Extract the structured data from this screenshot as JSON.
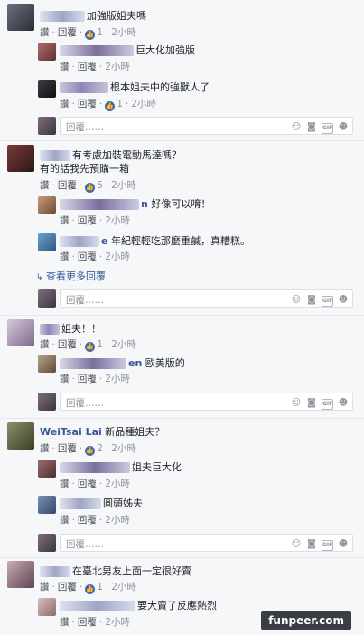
{
  "actions": {
    "like": "讚",
    "reply": "回覆"
  },
  "reply_placeholder": "回覆……",
  "icons": {
    "emoji": "smile-icon",
    "camera": "camera-icon",
    "gif": "gif-icon",
    "sticker": "sticker-icon"
  },
  "gif_text": "GIF",
  "threads": [
    {
      "comment": {
        "text": "加強版姐夫嗎",
        "likes": "1",
        "time": "2小時"
      },
      "replies": [
        {
          "text": "巨大化加強版",
          "likes": "",
          "time": "2小時"
        },
        {
          "text": "根本姐夫中的強獸人了",
          "likes": "1",
          "time": "2小時"
        }
      ]
    },
    {
      "comment": {
        "line1": "有考慮加裝電動馬達嗎？",
        "line2": "有的話我先預購一箱",
        "likes": "5",
        "time": "2小時"
      },
      "replies": [
        {
          "text": "好像可以唷！",
          "name_tail": "n",
          "likes": "",
          "time": "2小時"
        },
        {
          "text": "年紀輕輕吃那麼重鹹，真糟糕。",
          "name_tail": "e",
          "likes": "",
          "time": "2小時"
        }
      ],
      "more_replies": "查看更多回覆"
    },
    {
      "comment": {
        "text": "姐夫！！",
        "likes": "1",
        "time": "2小時"
      },
      "replies": [
        {
          "text": "歐美版的",
          "name_tail": "en",
          "likes": "",
          "time": "2小時"
        }
      ]
    },
    {
      "comment": {
        "author": "WeiTsai Lai",
        "text": "新品種姐夫？",
        "likes": "2",
        "time": "2小時"
      },
      "replies": [
        {
          "text": "姐夫巨大化",
          "likes": "",
          "time": "2小時"
        },
        {
          "text": "圓頭姊夫",
          "likes": "",
          "time": "2小時"
        }
      ]
    },
    {
      "comment": {
        "text": "在臺北男友上面一定很好賣",
        "likes": "1",
        "time": "2小時"
      },
      "replies": [
        {
          "text": "要大賣了反應熱烈",
          "likes": "",
          "time": "2小時"
        }
      ]
    }
  ],
  "watermark": "funpeer.com"
}
